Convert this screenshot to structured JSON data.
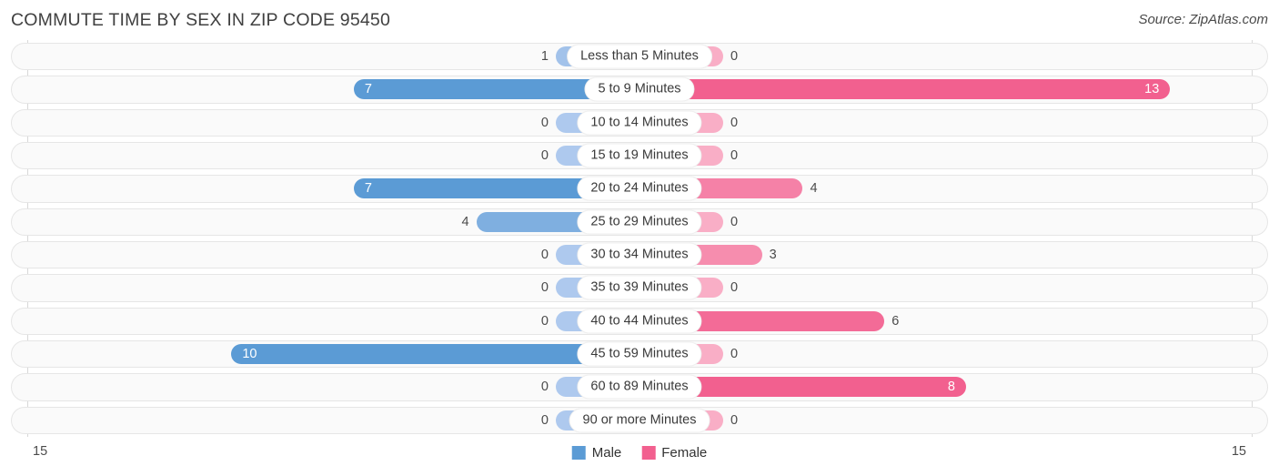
{
  "header": {
    "title": "COMMUTE TIME BY SEX IN ZIP CODE 95450",
    "source": "Source: ZipAtlas.com"
  },
  "legend": {
    "male_label": "Male",
    "female_label": "Female",
    "male_color": "#5B9BD5",
    "female_color": "#F2608F"
  },
  "axis": {
    "left_max": "15",
    "right_max": "15"
  },
  "chart_data": {
    "type": "bar",
    "title": "COMMUTE TIME BY SEX IN ZIP CODE 95450",
    "subtitle": "Source: ZipAtlas.com",
    "orientation": "horizontal-diverging",
    "xlabel": "",
    "ylabel": "",
    "xlim": [
      15,
      15
    ],
    "grid": false,
    "legend_position": "bottom-center",
    "categories": [
      "Less than 5 Minutes",
      "5 to 9 Minutes",
      "10 to 14 Minutes",
      "15 to 19 Minutes",
      "20 to 24 Minutes",
      "25 to 29 Minutes",
      "30 to 34 Minutes",
      "35 to 39 Minutes",
      "40 to 44 Minutes",
      "45 to 59 Minutes",
      "60 to 89 Minutes",
      "90 or more Minutes"
    ],
    "series": [
      {
        "name": "Male",
        "values": [
          1,
          7,
          0,
          0,
          7,
          4,
          0,
          0,
          0,
          10,
          0,
          0
        ]
      },
      {
        "name": "Female",
        "values": [
          0,
          13,
          0,
          0,
          4,
          0,
          3,
          0,
          6,
          0,
          8,
          0
        ]
      }
    ]
  },
  "rows": [
    {
      "label": "Less than 5 Minutes",
      "male": "1",
      "female": "0"
    },
    {
      "label": "5 to 9 Minutes",
      "male": "7",
      "female": "13"
    },
    {
      "label": "10 to 14 Minutes",
      "male": "0",
      "female": "0"
    },
    {
      "label": "15 to 19 Minutes",
      "male": "0",
      "female": "0"
    },
    {
      "label": "20 to 24 Minutes",
      "male": "7",
      "female": "4"
    },
    {
      "label": "25 to 29 Minutes",
      "male": "4",
      "female": "0"
    },
    {
      "label": "30 to 34 Minutes",
      "male": "0",
      "female": "3"
    },
    {
      "label": "35 to 39 Minutes",
      "male": "0",
      "female": "0"
    },
    {
      "label": "40 to 44 Minutes",
      "male": "0",
      "female": "6"
    },
    {
      "label": "45 to 59 Minutes",
      "male": "10",
      "female": "0"
    },
    {
      "label": "60 to 89 Minutes",
      "male": "0",
      "female": "8"
    },
    {
      "label": "90 or more Minutes",
      "male": "0",
      "female": "0"
    }
  ]
}
